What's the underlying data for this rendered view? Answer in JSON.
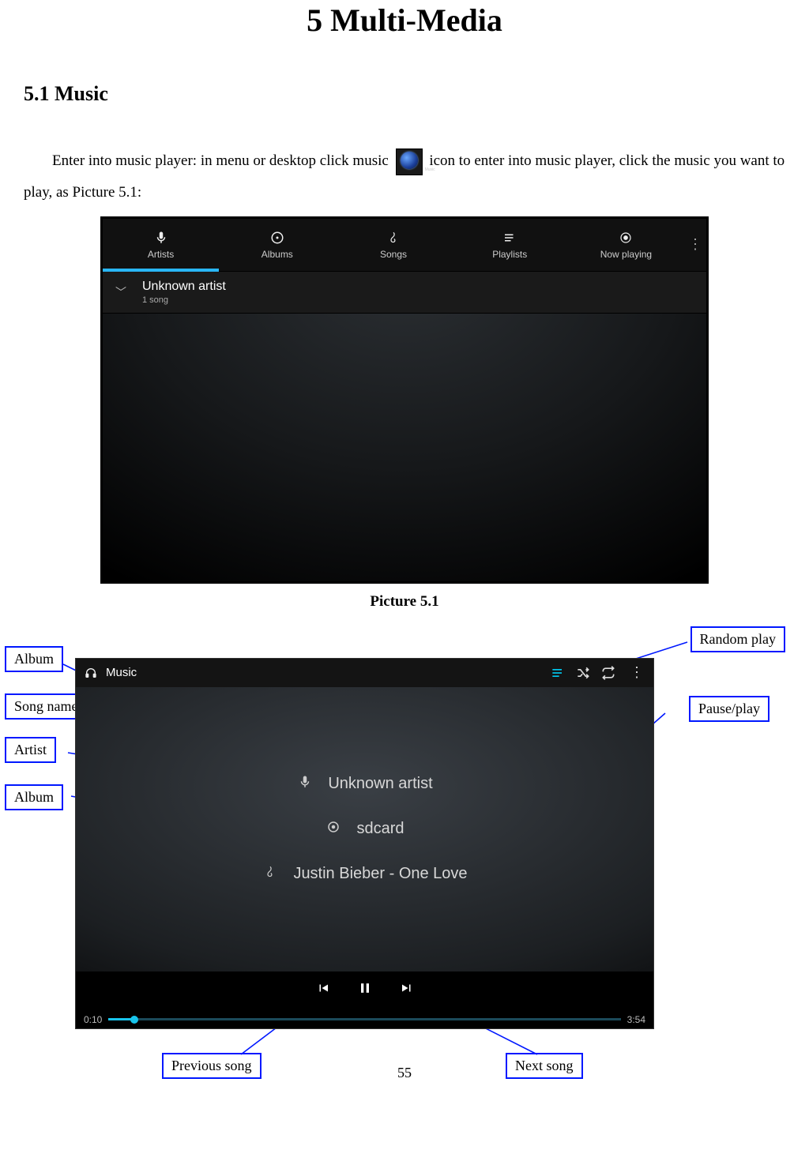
{
  "chapter_title": "5 Multi-Media",
  "section_title": "5.1 Music",
  "para1_a": "Enter into music player: in menu or desktop click music ",
  "para1_b": " icon to enter into music player, click the music you want to play, as Picture 5.1:",
  "caption1": "Picture 5.1",
  "page_number": "55",
  "shot1": {
    "tabs": [
      "Artists",
      "Albums",
      "Songs",
      "Playlists",
      "Now playing"
    ],
    "row_title": "Unknown artist",
    "row_sub": "1 song"
  },
  "shot2": {
    "app_title": "Music",
    "artist_line": "Unknown artist",
    "album_line": "sdcard",
    "song_line": "Justin Bieber - One Love",
    "elapsed": "0:10",
    "total": "3:54"
  },
  "callouts": {
    "left1": "Album",
    "left2": "Song name",
    "left3": "Artist",
    "left4": "Album",
    "right1": "Random play",
    "right2": "Pause/play",
    "bottom1": "Previous song",
    "bottom2": "Next song"
  }
}
